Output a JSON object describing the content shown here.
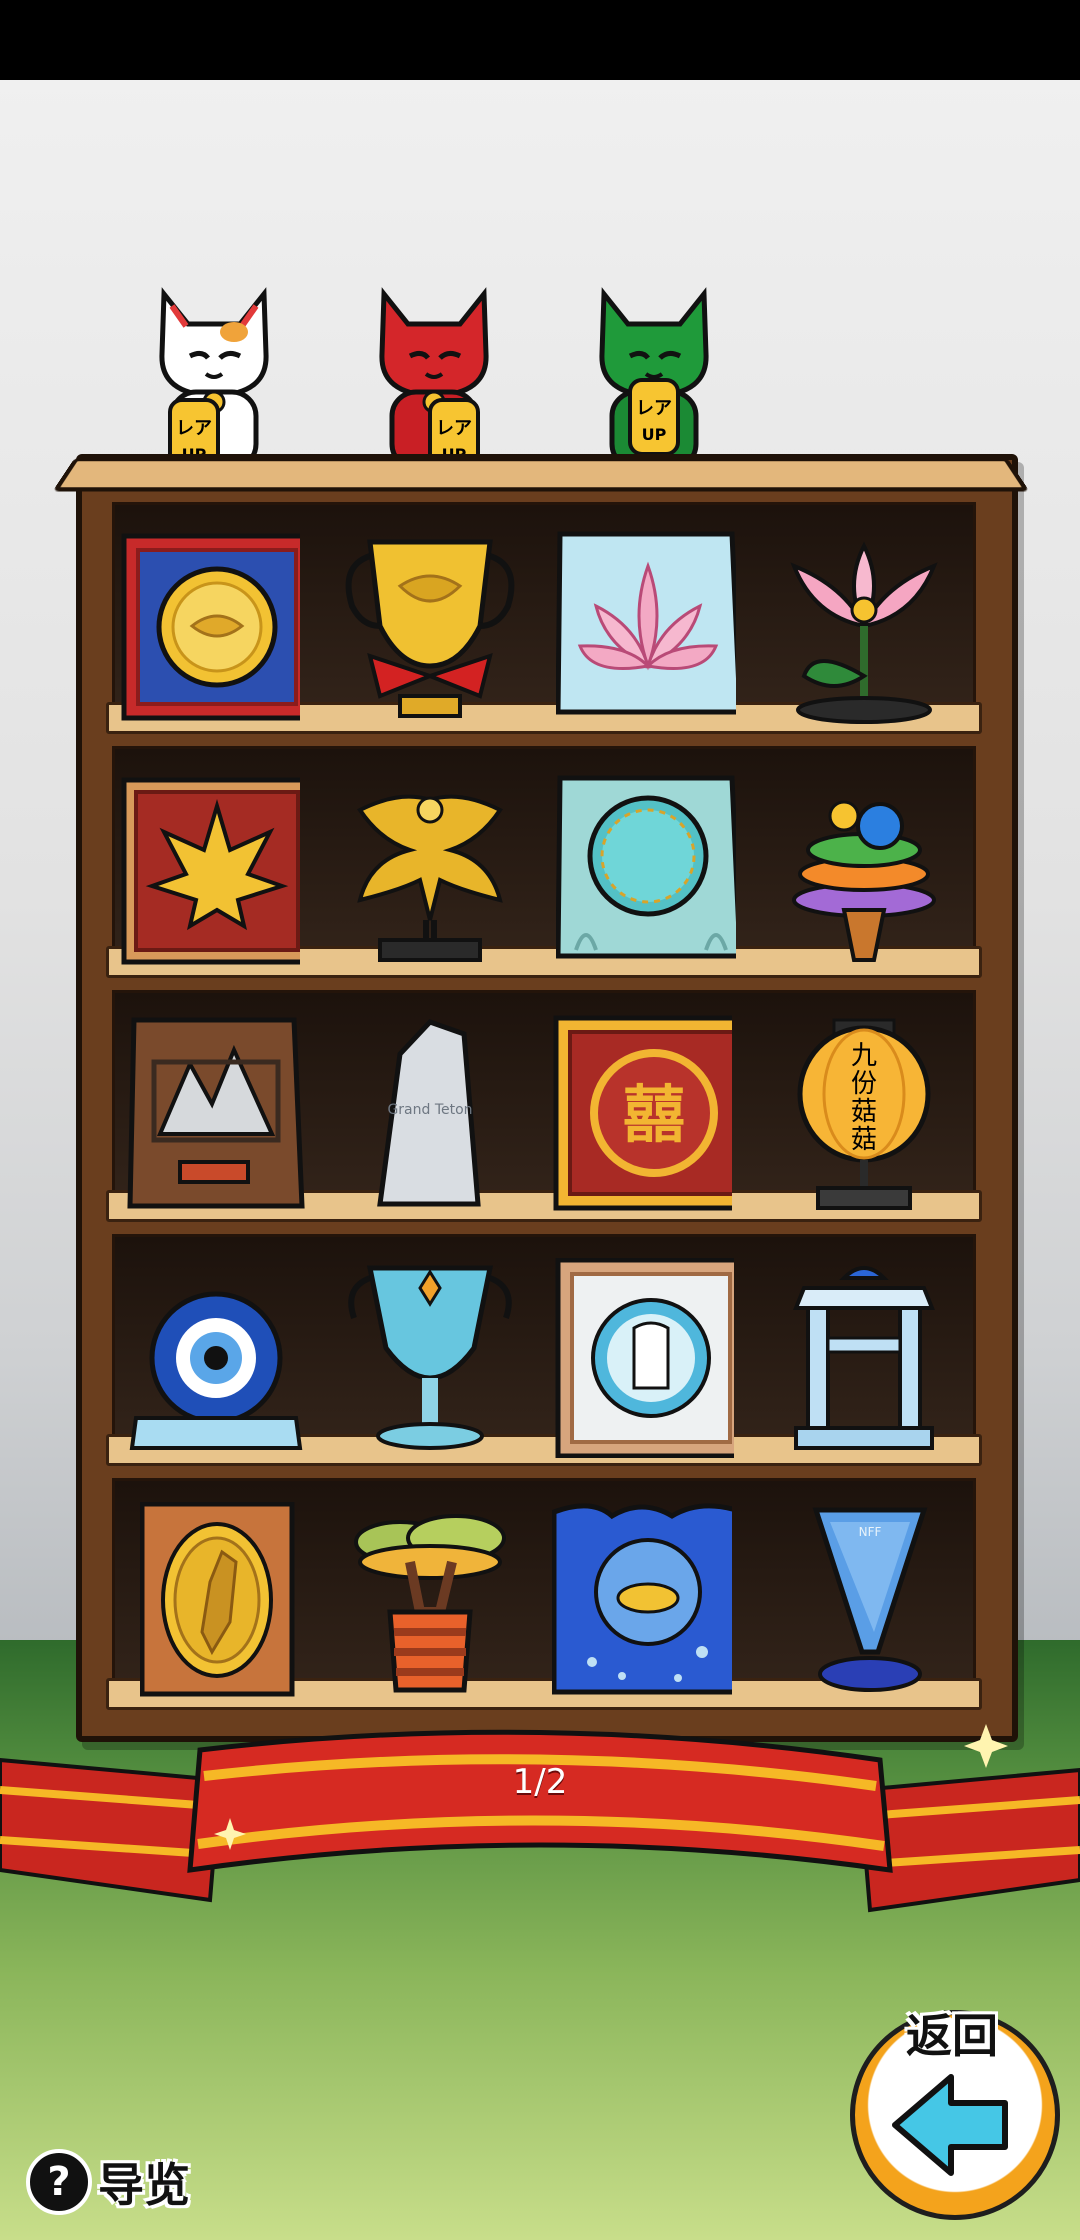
{
  "pagination": {
    "label": "1/2"
  },
  "nav": {
    "back_label": "返回",
    "guide_label": "导览"
  },
  "shelf_top_figures": [
    {
      "name": "white-lucky-cat",
      "badge": "レアUP"
    },
    {
      "name": "red-lucky-cat",
      "badge": "レアUP"
    },
    {
      "name": "green-lucky-cat",
      "badge": "レアUP"
    }
  ],
  "shelf_rows": [
    [
      "gold-coin-plaque-icon",
      "gold-trophy-cup-icon",
      "lotus-plaque-icon",
      "lotus-flower-icon"
    ],
    [
      "maple-leaf-plaque-icon",
      "golden-phoenix-icon",
      "turquoise-medallion-plaque-icon",
      "coral-reef-sculpture-icon"
    ],
    [
      "mountain-plaque-icon",
      "grand-teton-crystal-icon",
      "double-happiness-plaque-icon",
      "paper-lantern-icon"
    ],
    [
      "evil-eye-bead-icon",
      "blue-crystal-cup-icon",
      "creature-portrait-plaque-icon",
      "temple-pavilion-icon"
    ],
    [
      "madagascar-medal-plaque-icon",
      "baobab-tree-vase-icon",
      "submarine-wave-plaque-icon",
      "blue-cone-trophy-icon"
    ]
  ],
  "item_texts": {
    "grand_teton": "Grand Teton",
    "lantern_chars": [
      "九",
      "份",
      "菇",
      "菇"
    ],
    "nff": "NFF"
  },
  "colors": {
    "accent_red": "#d62a22",
    "ribbon_gold": "#f6b826",
    "back_orange": "#f4a31c",
    "back_arrow": "#45c7e6",
    "shelf_wood": "#6a3e1e",
    "plank_wood": "#e8c48b"
  }
}
